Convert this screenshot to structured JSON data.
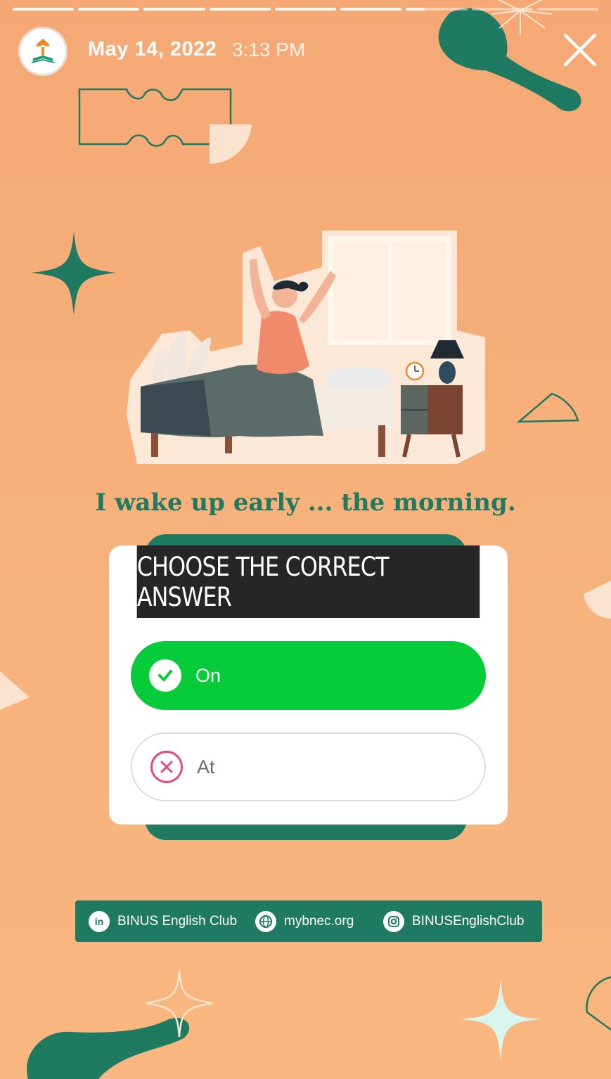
{
  "story": {
    "segments": 9,
    "completed_segments": 6,
    "date": "May 14, 2022",
    "time": "3:13 PM"
  },
  "question": {
    "text": "I wake up early ... the morning."
  },
  "quiz": {
    "title": "CHOOSE THE CORRECT ANSWER",
    "options": [
      {
        "label": "On",
        "state": "correct"
      },
      {
        "label": "At",
        "state": "wrong"
      }
    ]
  },
  "footer": {
    "linkedin": "BINUS English Club",
    "website": "mybnec.org",
    "instagram": "BINUSEnglishClub"
  },
  "colors": {
    "background": "#f9b47a",
    "accent_green": "#1e7a61",
    "correct_green": "#05cc38",
    "wrong_pink": "#e8467f",
    "header_dark": "#262626"
  }
}
